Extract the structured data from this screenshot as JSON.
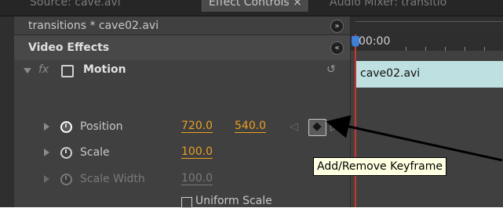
{
  "tabs": [
    "Source: cave.avi",
    "Effect Controls ×",
    "Audio Mixer: transitio"
  ],
  "clip": {
    "name": "transitions * cave02.avi",
    "nav_icon": "double-chevron-right"
  },
  "video_effects": {
    "label": "Video Effects",
    "collapse_icon": "double-chevron-up"
  },
  "motion": {
    "label": "Motion",
    "fx_label": "fx",
    "reset_icon": "reset-arrow"
  },
  "properties": [
    {
      "name": "Position",
      "value1": "720.0",
      "value2": "540.0",
      "stopwatch_active": true
    },
    {
      "name": "Scale",
      "value1": "100.0",
      "stopwatch_active": false
    },
    {
      "name": "Scale Width",
      "value1": "100.0",
      "stopwatch_active": false,
      "disabled": true
    }
  ],
  "uniform_scale": "Uniform Scale",
  "timeline": {
    "time": "00:00",
    "clip": "cave02.avi"
  },
  "tooltip": "Add/Remove Keyframe",
  "colors": {
    "value_orange": "#e8a020",
    "playhead": "#d0332b",
    "clip_bar": "#bfe0e0"
  }
}
